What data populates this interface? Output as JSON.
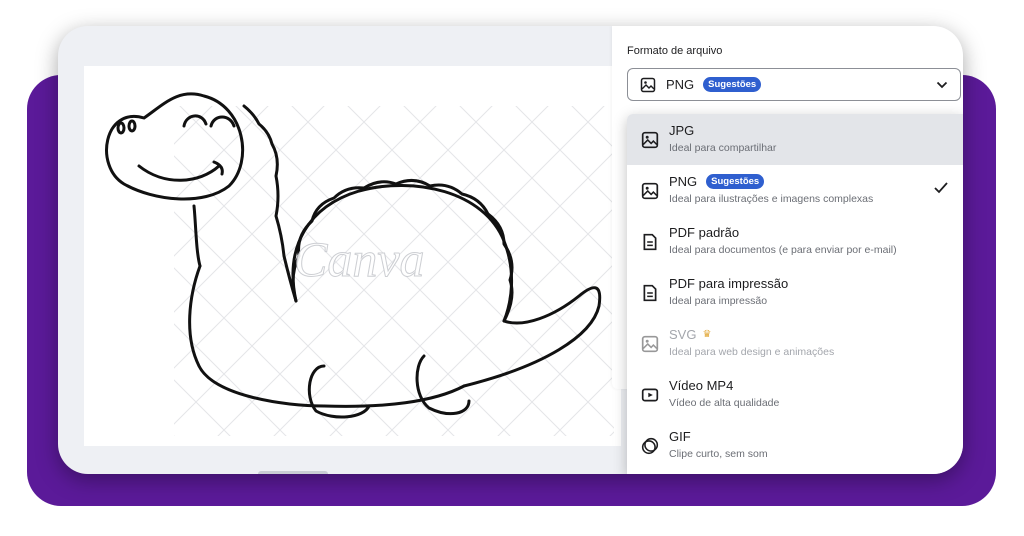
{
  "export_panel": {
    "format_label": "Formato de arquivo",
    "selected_format": "PNG",
    "selected_badge": "Sugestões",
    "selected_icon": "image-icon"
  },
  "format_options": [
    {
      "title": "JPG",
      "desc": "Ideal para compartilhar",
      "icon": "image-icon",
      "badge": "",
      "highlighted": true
    },
    {
      "title": "PNG",
      "desc": "Ideal para ilustrações e imagens complexas",
      "icon": "image-icon",
      "badge": "Sugestões",
      "selected": true
    },
    {
      "title": "PDF padrão",
      "desc": "Ideal para documentos (e para enviar por e-mail)",
      "icon": "document-icon"
    },
    {
      "title": "PDF para impressão",
      "desc": "Ideal para impressão",
      "icon": "document-icon"
    },
    {
      "title": "SVG",
      "desc": "Ideal para web design e animações",
      "icon": "image-icon",
      "premium": true
    },
    {
      "title": "Vídeo MP4",
      "desc": "Vídeo de alta qualidade",
      "icon": "video-icon"
    },
    {
      "title": "GIF",
      "desc": "Clipe curto, sem som",
      "icon": "gif-icon"
    }
  ],
  "canvas": {
    "watermark": "Canva",
    "image_subject": "dinosaur-line-drawing"
  },
  "colors": {
    "backdrop": "#5b1a99",
    "badge": "#2f5fcf",
    "highlight": "#e3e5e9",
    "crown": "#e2a93b"
  }
}
